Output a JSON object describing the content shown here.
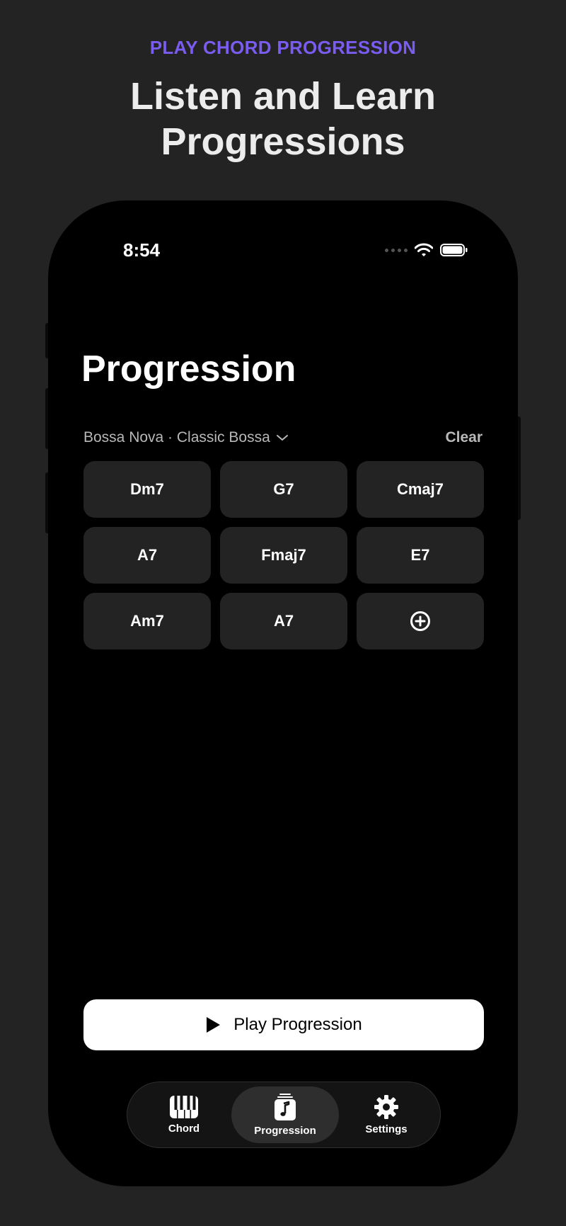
{
  "promo": {
    "eyebrow": "PLAY CHORD PROGRESSION",
    "headline_line1": "Listen and Learn",
    "headline_line2": "Progressions",
    "eyebrow_color": "#7b5cf0"
  },
  "status_bar": {
    "time": "8:54",
    "icons": [
      "signal-dots-icon",
      "wifi-icon",
      "battery-icon"
    ]
  },
  "screen": {
    "title": "Progression",
    "preset_label": "Bossa Nova · Classic Bossa",
    "clear_label": "Clear",
    "chords": [
      "Dm7",
      "G7",
      "Cmaj7",
      "A7",
      "Fmaj7",
      "E7",
      "Am7",
      "A7"
    ],
    "add_icon": "plus-circle-icon",
    "play_label": "Play Progression"
  },
  "tabs": [
    {
      "label": "Chord",
      "icon": "piano-icon",
      "active": false
    },
    {
      "label": "Progression",
      "icon": "music-note-icon",
      "active": true
    },
    {
      "label": "Settings",
      "icon": "gear-icon",
      "active": false
    }
  ]
}
